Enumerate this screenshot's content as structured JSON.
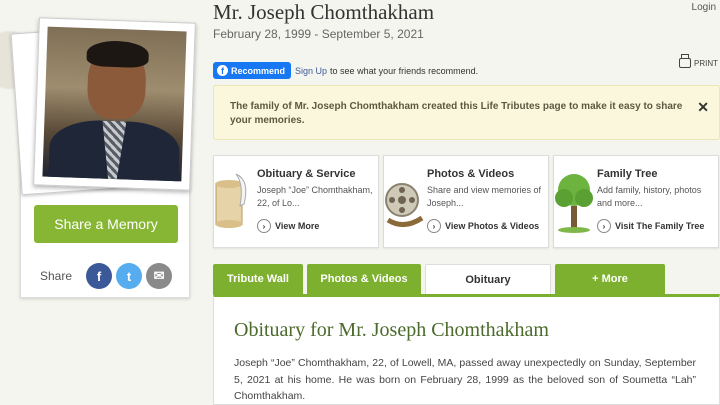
{
  "header": {
    "name": "Mr. Joseph Chomthakham",
    "dates": "February 28, 1999 - September 5, 2021",
    "login": "Login"
  },
  "facebook": {
    "recommend": "Recommend",
    "signup": "Sign Up",
    "text": "to see what your friends recommend."
  },
  "print_label": "PRINT",
  "notice": {
    "text": "The family of Mr. Joseph Chomthakham created this Life Tributes page to make it easy to share your memories."
  },
  "sidebar": {
    "share_memory": "Share a Memory",
    "share_label": "Share",
    "icons": {
      "facebook": "f",
      "twitter": "t",
      "email": "✉"
    }
  },
  "features": [
    {
      "title": "Obituary & Service",
      "desc": "Joseph “Joe” Chomthakham, 22, of Lo...",
      "link": "View More"
    },
    {
      "title": "Photos & Videos",
      "desc": "Share and view memories of Joseph...",
      "link": "View Photos & Videos"
    },
    {
      "title": "Family Tree",
      "desc": "Add family, history, photos and more...",
      "link": "Visit The Family Tree"
    }
  ],
  "tabs": [
    "Tribute Wall",
    "Photos & Videos",
    "Obituary",
    "+ More"
  ],
  "obituary": {
    "title": "Obituary for Mr. Joseph Chomthakham",
    "text": "Joseph “Joe” Chomthakham, 22, of Lowell, MA, passed away unexpectedly on Sunday, September 5, 2021 at his home. He was born on February 28, 1999 as the beloved son of Soumetta “Lah” Chomthakham."
  },
  "colors": {
    "accent": "#7db02e",
    "button": "#86b634",
    "facebook": "#3b5998"
  }
}
